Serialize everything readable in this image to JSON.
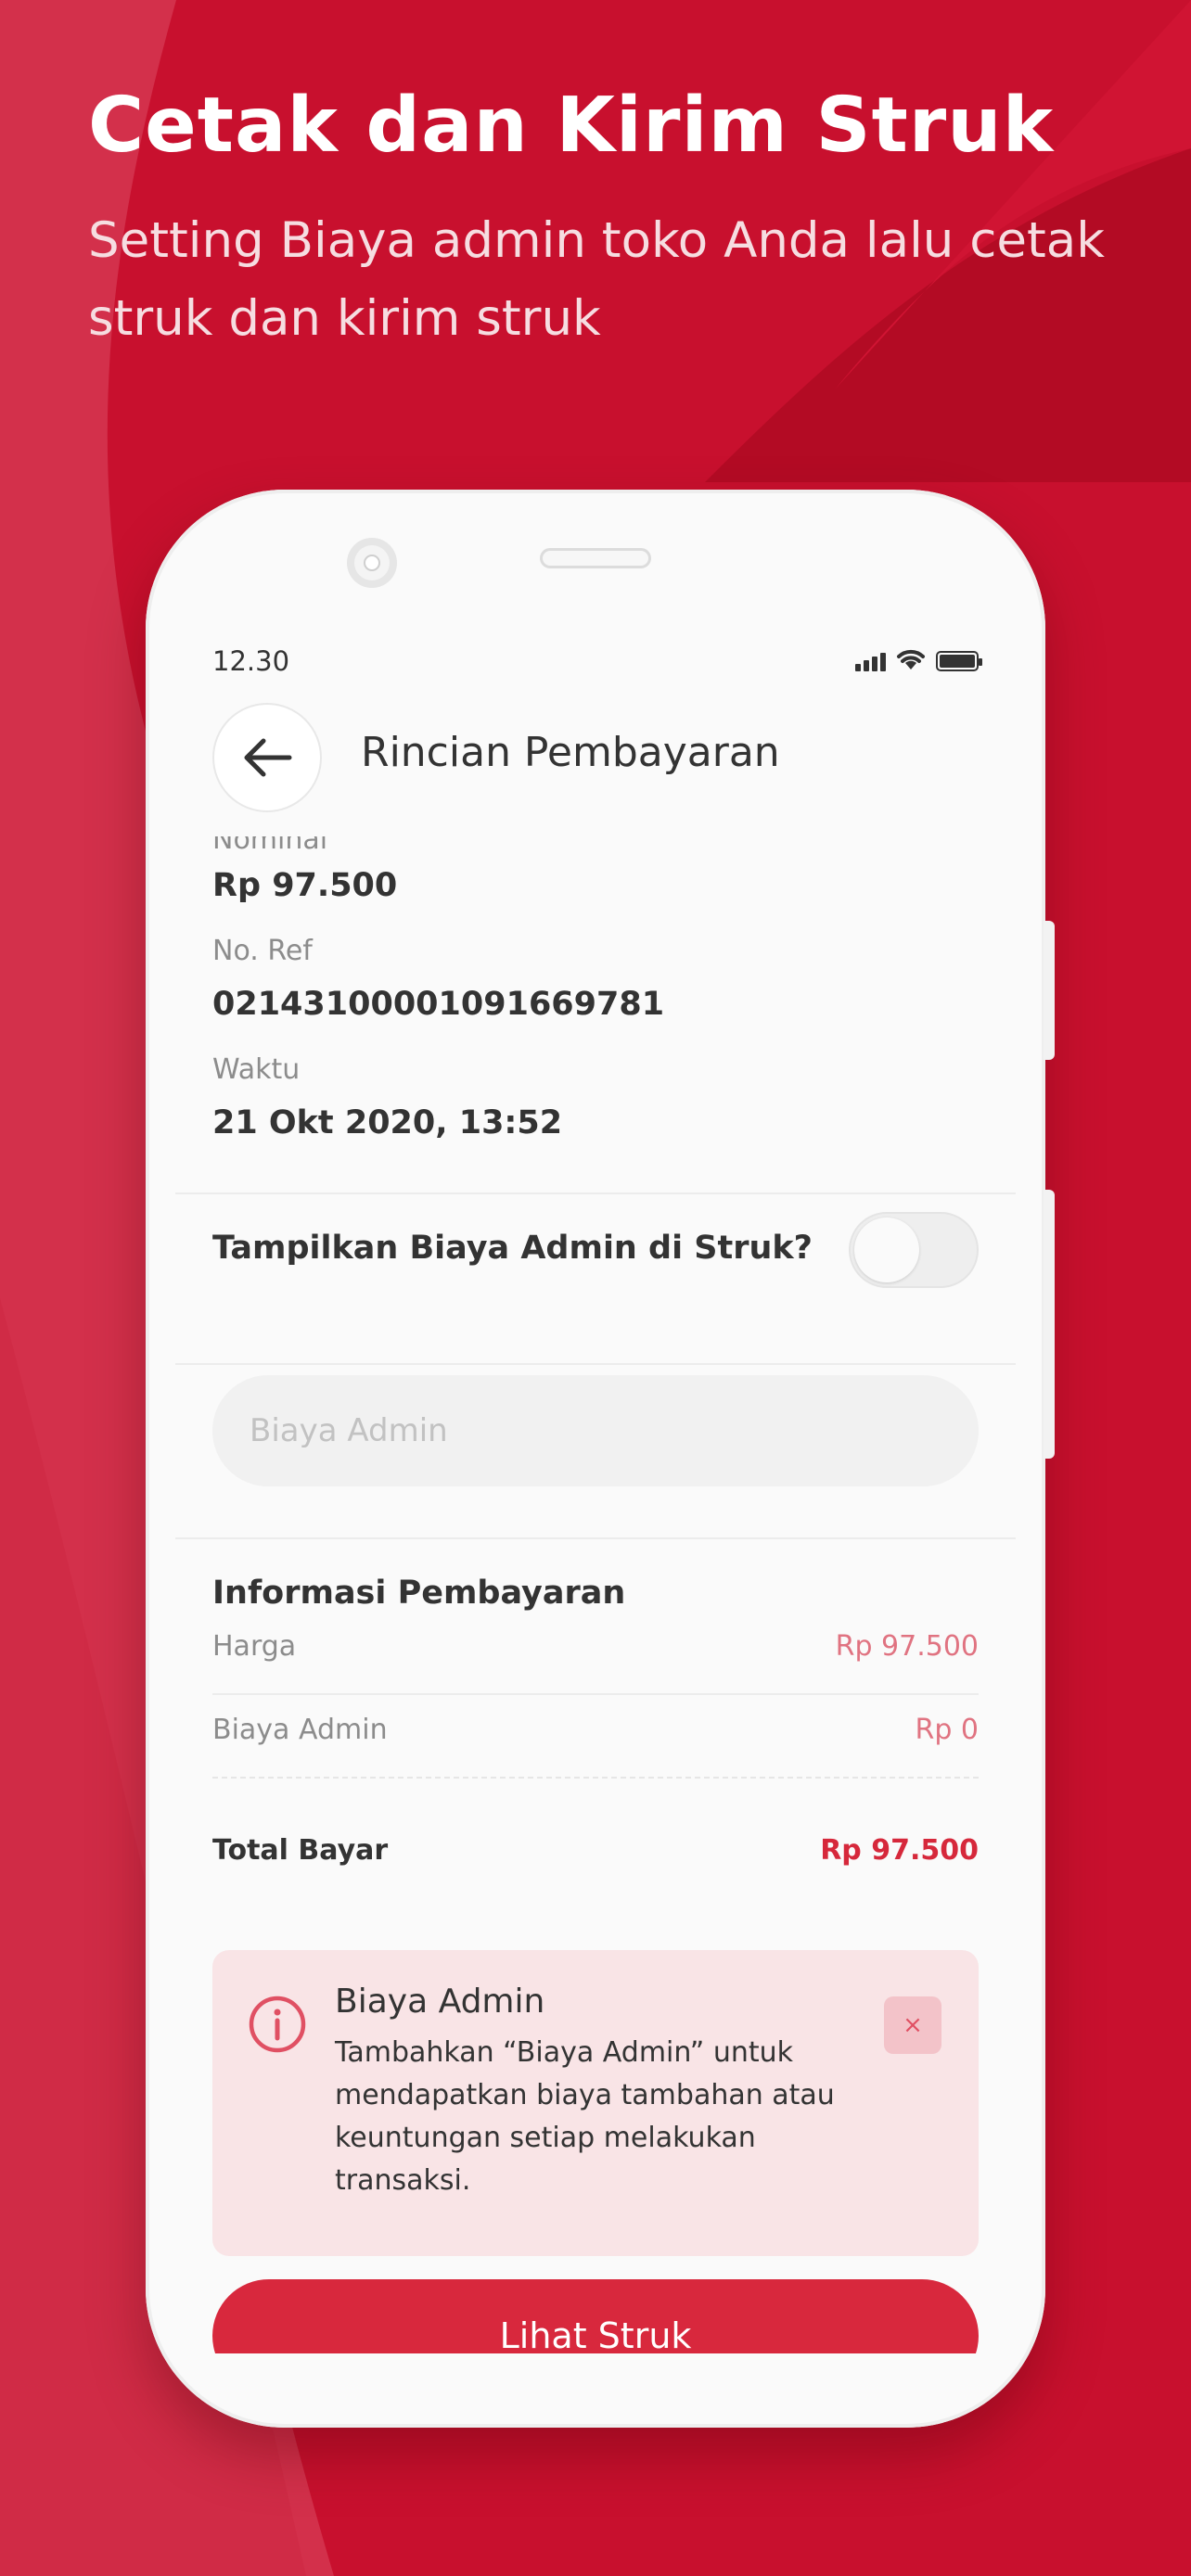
{
  "promo": {
    "headline": "Cetak dan Kirim Struk",
    "subline": "Setting Biaya admin toko Anda lalu cetak struk dan kirim struk"
  },
  "status_bar": {
    "time": "12.30",
    "icons": [
      "signal-icon",
      "wifi-icon",
      "battery-icon"
    ]
  },
  "header": {
    "back_icon": "arrow-left-icon",
    "title": "Rincian Pembayaran"
  },
  "details": [
    {
      "label": "Nominal",
      "value": "Rp 97.500"
    },
    {
      "label": "No. Ref",
      "value": "02143100001091669781"
    },
    {
      "label": "Waktu",
      "value": "21 Okt 2020, 13:52"
    }
  ],
  "admin_toggle": {
    "label": "Tampilkan Biaya Admin di Struk?",
    "on": false
  },
  "admin_input": {
    "value": "",
    "placeholder": "Biaya Admin"
  },
  "payment_info": {
    "title": "Informasi Pembayaran",
    "rows": [
      {
        "label": "Harga",
        "value": "Rp 97.500"
      },
      {
        "label": "Biaya Admin",
        "value": "Rp 0"
      }
    ],
    "total_label": "Total Bayar",
    "total_value": "Rp 97.500"
  },
  "info_box": {
    "icon": "info-icon",
    "title": "Biaya Admin",
    "text": "Tambahkan “Biaya Admin” untuk mendapatkan biaya tambahan atau keuntungan setiap melakukan transaksi.",
    "close_label": "×"
  },
  "cta": {
    "label": "Lihat Struk"
  },
  "colors": {
    "brand_red": "#c8102e",
    "button_red": "#d8283d",
    "price_pink": "#e07381",
    "info_bg": "#f9e4e6"
  }
}
